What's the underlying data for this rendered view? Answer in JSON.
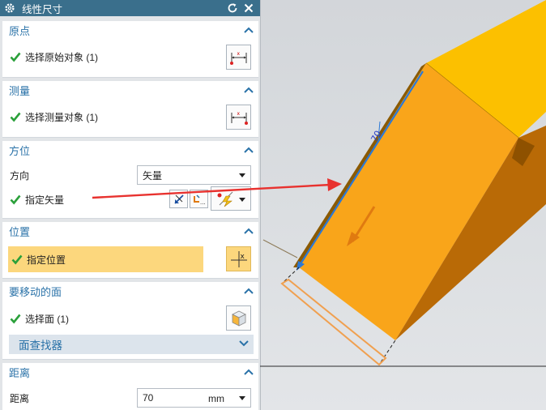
{
  "dialog": {
    "title": "线性尺寸",
    "title_icon": "gear-icon",
    "buttons": [
      "reset-icon",
      "close-icon"
    ],
    "accent_color": "#2a72a8",
    "titlebar_color": "#3a6f8c"
  },
  "origin": {
    "title": "原点",
    "select_label": "选择原始对象 (1)"
  },
  "measure": {
    "title": "测量",
    "select_label": "选择测量对象 (1)"
  },
  "orientation": {
    "title": "方位",
    "direction_label": "方向",
    "direction_value": "矢量",
    "vector_label": "指定矢量"
  },
  "position": {
    "title": "位置",
    "specify_label": "指定位置",
    "highlight_color": "#fcd77d"
  },
  "faces": {
    "title": "要移动的面",
    "select_label": "选择面 (1)",
    "finder_label": "面查找器"
  },
  "distance": {
    "title": "距离",
    "label": "距离",
    "value": "70",
    "unit": "mm"
  },
  "viewport": {
    "dimension_text": "70",
    "model_color": "#f9a51a",
    "preview_color": "#f0a050",
    "annotation_arrow_color": "#e8322f"
  }
}
